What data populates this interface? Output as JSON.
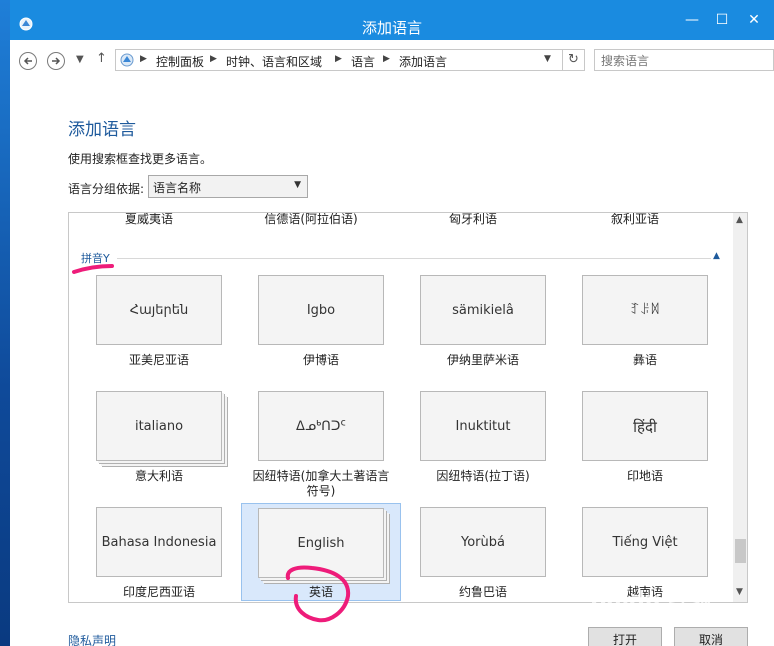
{
  "window": {
    "title": "添加语言",
    "min": "—",
    "max": "☐",
    "close": "✕"
  },
  "address": {
    "crumbs": [
      "控制面板",
      "时钟、语言和区域",
      "语言",
      "添加语言"
    ],
    "search_placeholder": "搜索语言"
  },
  "page": {
    "title": "添加语言",
    "description": "使用搜索框查找更多语言。",
    "group_label": "语言分组依据:",
    "group_value": "语言名称"
  },
  "previous_row": [
    "夏威夷语",
    "信德语(阿拉伯语)",
    "匈牙利语",
    "叙利亚语"
  ],
  "section": {
    "header": "拼音Y"
  },
  "languages": [
    {
      "native": "Հայերեն",
      "name": "亚美尼亚语"
    },
    {
      "native": "Igbo",
      "name": "伊博语"
    },
    {
      "native": "sämikielâ",
      "name": "伊纳里萨米语"
    },
    {
      "native": "ꆈꌠꉙ",
      "name": "彝语"
    },
    {
      "native": "italiano",
      "name": "意大利语"
    },
    {
      "native": "ᐃᓄᒃᑎᑐᑦ",
      "name": "因纽特语(加拿大土著语言符号)"
    },
    {
      "native": "Inuktitut",
      "name": "因纽特语(拉丁语)"
    },
    {
      "native": "हिंदी",
      "name": "印地语"
    },
    {
      "native": "Bahasa Indonesia",
      "name": "印度尼西亚语"
    },
    {
      "native": "English",
      "name": "英语"
    },
    {
      "native": "Yorùbá",
      "name": "约鲁巴语"
    },
    {
      "native": "Tiếng Việt",
      "name": "越南语"
    }
  ],
  "footer": {
    "privacy": "隐私声明",
    "open": "打开",
    "cancel": "取消"
  },
  "watermark": "Baidu 经验",
  "colors": {
    "titlebar": "#1a8be0",
    "accent": "#1e5a9c",
    "selected": "#d9e8fb",
    "annotation": "#ee1c7a"
  }
}
